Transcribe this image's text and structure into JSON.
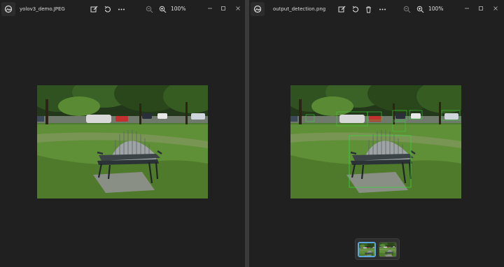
{
  "left_window": {
    "filename": "yolov3_demo.JPEG",
    "zoom": "100%",
    "toolbar": [
      "edit-icon",
      "rotate-icon",
      "more-icon"
    ],
    "zoom_controls": [
      "zoom-out-icon",
      "zoom-in-icon"
    ],
    "window_controls": [
      "minimize-icon",
      "maximize-icon",
      "close-icon"
    ]
  },
  "right_window": {
    "filename": "output_detection.png",
    "zoom": "100%",
    "toolbar": [
      "edit-icon",
      "rotate-icon",
      "delete-icon",
      "more-icon"
    ],
    "zoom_controls": [
      "zoom-out-icon",
      "zoom-in-icon"
    ],
    "window_controls": [
      "minimize-icon",
      "maximize-icon",
      "close-icon"
    ],
    "filmstrip": {
      "thumbnails": [
        "output_detection.png",
        "yolov3_demo.JPEG"
      ],
      "selected_index": 0
    }
  },
  "colors": {
    "window_bg": "#202020",
    "detection_box": "#3bd13b",
    "selection_accent": "#5aa7e0"
  }
}
